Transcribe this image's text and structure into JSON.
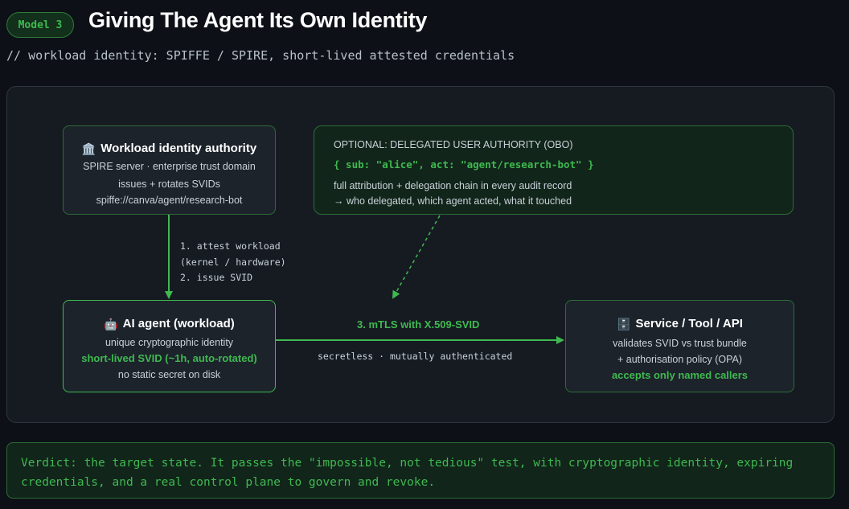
{
  "header": {
    "badge": "Model 3",
    "title": "Giving The Agent Its Own Identity",
    "subtitle": "// workload identity: SPIFFE / SPIRE, short-lived attested credentials"
  },
  "diagram": {
    "authority": {
      "icon": "🏛️",
      "icon_name": "classical-building-icon",
      "title": "Workload identity authority",
      "lines": [
        "SPIRE server · enterprise trust domain",
        "issues + rotates SVIDs",
        "spiffe://canva/agent/research-bot"
      ]
    },
    "obo": {
      "title": "OPTIONAL: DELEGATED USER AUTHORITY (OBO)",
      "code": "{ sub: \"alice\", act: \"agent/research-bot\" }",
      "lines": [
        "full attribution + delegation chain in every audit record",
        "→ who delegated, which agent acted, what it touched"
      ]
    },
    "attest_labels": [
      "1. attest workload",
      "(kernel / hardware)",
      "2. issue SVID"
    ],
    "agent": {
      "icon": "🤖",
      "icon_name": "robot-icon",
      "title": "AI agent (workload)",
      "line1": "unique cryptographic identity",
      "line2": "short-lived SVID (~1h, auto-rotated)",
      "line3": "no static secret on disk"
    },
    "mtls": {
      "title": "3. mTLS with X.509-SVID",
      "sub": "secretless · mutually authenticated"
    },
    "service": {
      "icon": "🗄️",
      "icon_name": "server-icon",
      "title": "Service / Tool / API",
      "line1": "validates SVID vs trust bundle",
      "line2": "+ authorisation policy (OPA)",
      "line3": "accepts only named callers"
    }
  },
  "verdict": "Verdict: the target state. It passes the \"impossible, not tedious\" test, with cryptographic identity, expiring credentials, and a real control plane to govern and revoke.",
  "colors": {
    "accent_green": "#3fb950",
    "background": "#0d1117",
    "panel": "#161b22",
    "box_border": "#2e6b37"
  }
}
